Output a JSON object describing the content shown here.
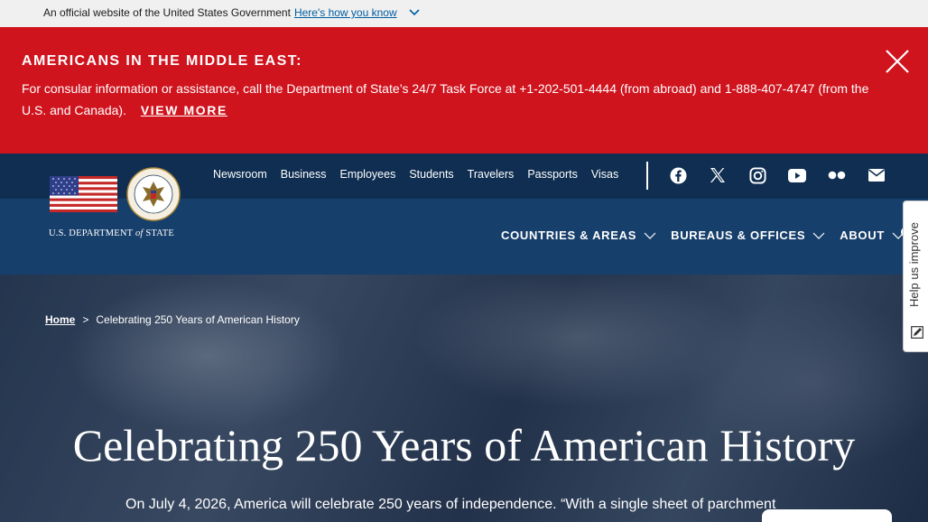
{
  "gov_banner": {
    "text": "An official website of the United States Government",
    "link": "Here's how you know"
  },
  "alert": {
    "title": "AMERICANS IN THE MIDDLE EAST:",
    "body": "For consular information or assistance, call the Department of State’s 24/7 Task Force at +1-202-501-4444 (from abroad) and 1-888-407-4747 (from the U.S. and Canada).",
    "link": "VIEW MORE"
  },
  "logo": {
    "wordmark_prefix": "U.S. DEPARTMENT",
    "wordmark_of": "of",
    "wordmark_suffix": "STATE"
  },
  "utility_nav": [
    "Newsroom",
    "Business",
    "Employees",
    "Students",
    "Travelers",
    "Passports",
    "Visas"
  ],
  "main_nav": [
    "COUNTRIES & AREAS",
    "BUREAUS & OFFICES",
    "ABOUT"
  ],
  "breadcrumb": {
    "home": "Home",
    "separator": ">",
    "current": "Celebrating 250 Years of American History"
  },
  "hero": {
    "title": "Celebrating 250 Years of American History",
    "text": "On July 4, 2026, America will celebrate 250 years of independence. “With a single sheet of parchment"
  },
  "feedback": {
    "label": "Help us improve"
  },
  "colors": {
    "alert_red": "#d0141e",
    "header_dark": "#0f2e51",
    "header_blue": "#173f6b",
    "link_blue": "#005ea2"
  }
}
